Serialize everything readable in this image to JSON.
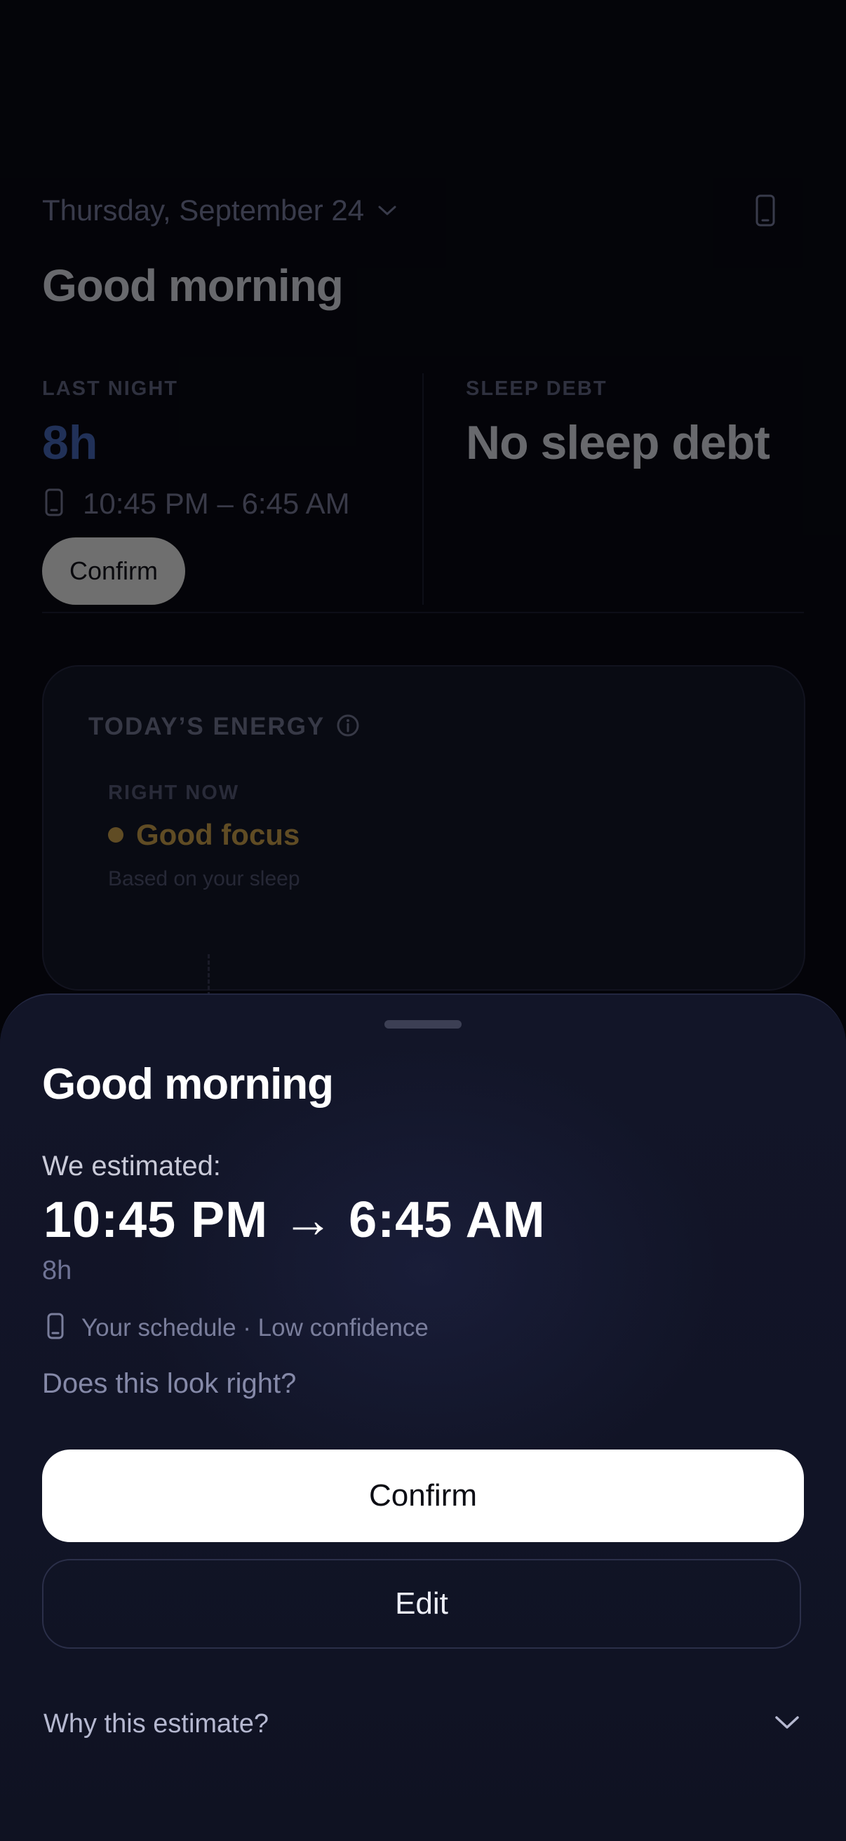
{
  "header": {
    "date": "Thursday, September 24",
    "greeting": "Good morning"
  },
  "stats": {
    "last_night_label": "LAST NIGHT",
    "last_night_value": "8h",
    "time_range": "10:45 PM – 6:45 AM",
    "confirm_label": "Confirm",
    "sleep_debt_label": "SLEEP DEBT",
    "sleep_debt_value": "No sleep debt"
  },
  "energy": {
    "title": "TODAY’S ENERGY",
    "right_now_label": "RIGHT NOW",
    "status": "Good focus",
    "status_color": "#9c7b3a",
    "subtitle": "Based on your sleep"
  },
  "sheet": {
    "title": "Good morning",
    "estimated_label": "We estimated:",
    "estimated_range": "10:45 PM → 6:45 AM",
    "duration": "8h",
    "source": "Your schedule · Low confidence",
    "question": "Does this look right?",
    "confirm_label": "Confirm",
    "edit_label": "Edit",
    "why_label": "Why this estimate?"
  },
  "icons": {
    "date_dropdown": "chevron-down-icon",
    "device": "phone-icon",
    "info": "info-icon",
    "why_expand": "chevron-down-icon"
  }
}
